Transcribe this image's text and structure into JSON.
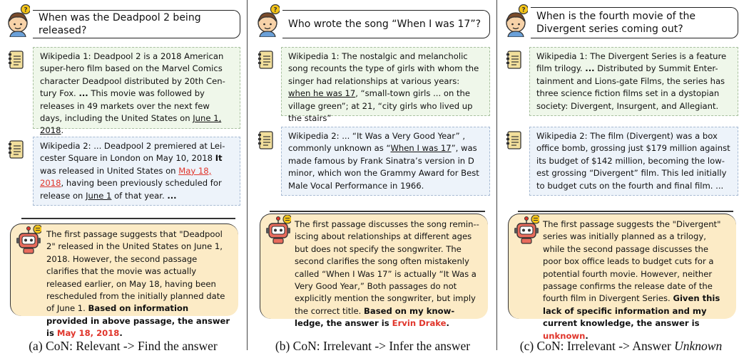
{
  "panels": [
    {
      "question": "When was the Deadpool 2 being released?",
      "p1": {
        "t1": "Wikipedia 1: Deadpool 2 is a 2018 American super-hero film based on the Marvel Comics character Deadpool distributed by 20th Cen-tury Fox. ",
        "b1": "...",
        "t2": " This movie was followed by releases  in 49 markets over the next few days, including the United States on ",
        "u1": "June 1, 2018",
        "t3": "."
      },
      "p2": {
        "t1": "Wikipedia 2: ... Deadpool 2 premiered at Lei-cester Square in London on May 10, 2018 ",
        "b1": "It",
        "t2": " was released in United States on ",
        "r1": "May 18, 2018",
        "t3": ", having been previously scheduled for release on ",
        "u1": "June 1",
        "t4": " of that year. ",
        "b2": "..."
      },
      "note": {
        "t1": "The first passage suggests that \"Deadpool 2\" released in the United States on June 1, 2018. However, the second passage clarifies that the movie was actually released earlier, on May 18, having been rescheduled from the initially planned date of June 1. ",
        "b1": "Based on information provided in above passage, the answer is ",
        "r1": "May 18, 2018",
        "b2": "."
      },
      "caption": "(a) CoN: Relevant -> Find the answer"
    },
    {
      "question": "Who wrote the song “When I was 17”?",
      "p1": {
        "t1": "Wikipedia 1: The nostalgic and melancholic song recounts the type of girls with whom the singer had relationships at various years: ",
        "u1": "when he was 17",
        "t2": ", “small-town girls ... on the village green”; at 21, “city girls who lived up the stairs”"
      },
      "p2": {
        "t1": "Wikipedia 2: ... “It Was a Very Good Year” , commonly unknown as “",
        "u1": "When I was 17",
        "t2": "”, was made famous by Frank Sinatra’s version in D minor, which won the Grammy Award for Best Male Vocal Performance in 1966."
      },
      "note": {
        "t1": "The first passage discusses the song remin--iscing about relationships at different ages but does not specify the songwriter. The second clarifies the song often mistakenly called “When I Was 17” is actually “It Was a Very Good Year,” Both passages do not explicitly mention the songwriter, but imply the correct title. ",
        "b1": "Based on my know-ledge, the answer is ",
        "r1": "Ervin Drake",
        "b2": "."
      },
      "caption": "(b) CoN: Irrelevant -> Infer the answer"
    },
    {
      "question": "When is the fourth movie of the Divergent series coming out?",
      "p1": {
        "t1": "Wikipedia 1: The Divergent Series is a feature film trilogy. ",
        "b1": "...",
        "t2": " Distributed by Summit Enter-tainment and Lions-gate Films, the series has three science fiction films set in a dystopian society: Divergent, Insurgent, and Allegiant."
      },
      "p2": {
        "t1": "Wikipedia 2: The film (Divergent) was a box office bomb, grossing just $179 million against its budget of $142 million, becoming the low-est grossing “Divergent” film. This led initially to budget cuts on the fourth and final film. ..."
      },
      "note": {
        "t1": "The first passage suggests the \"Divergent\" series was initially planned as a trilogy, while the second passage discusses the poor box office leads to budget cuts for a potential fourth movie. However, neither passage confirms the release date of the fourth film in Divergent Series. ",
        "b1": "Given this lack of specific information and my current knowledge, the answer is ",
        "r1": "unknown",
        "b2": "."
      },
      "caption_main": "(c) CoN: Irrelevant -> Answer ",
      "caption_italic": "Unknown"
    }
  ]
}
